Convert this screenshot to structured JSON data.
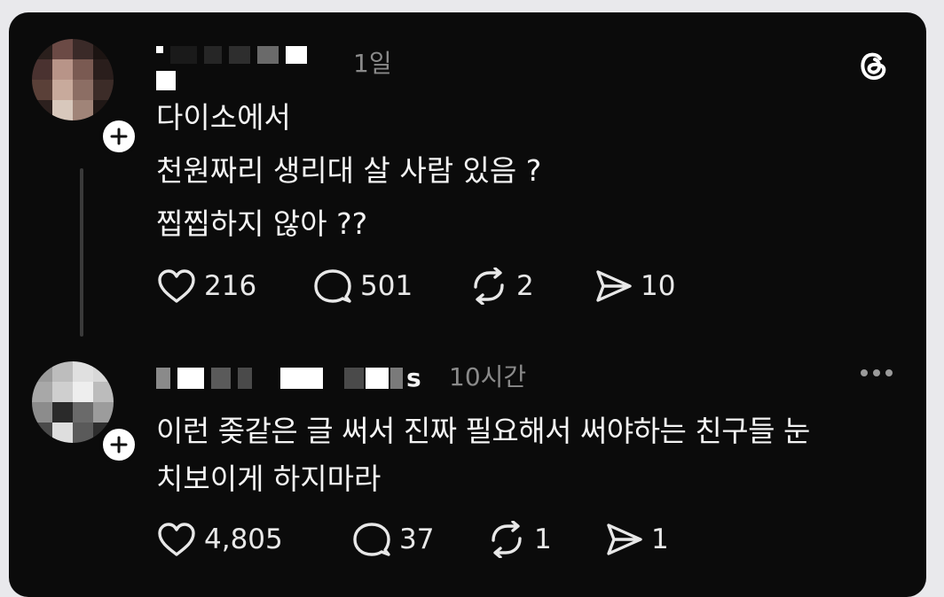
{
  "post": {
    "time": "1일",
    "lines": [
      "다이소에서",
      "천원짜리 생리대 살 사람 있음 ?",
      "찝찝하지 않아 ??"
    ],
    "likes": "216",
    "replies": "501",
    "reposts": "2",
    "shares": "10"
  },
  "reply": {
    "username_tail": "s",
    "time": "10시간",
    "lines": [
      "이런 좆같은 글 써서 진짜 필요해서 써야하는 친구들 눈",
      "치보이게 하지마라"
    ],
    "likes": "4,805",
    "replies": "37",
    "reposts": "1",
    "shares": "1"
  },
  "icons": {
    "brand": "threads-logo-icon",
    "like": "heart-icon",
    "reply": "comment-icon",
    "repost": "repost-icon",
    "share": "send-icon",
    "follow": "plus-icon",
    "more": "more-icon"
  }
}
